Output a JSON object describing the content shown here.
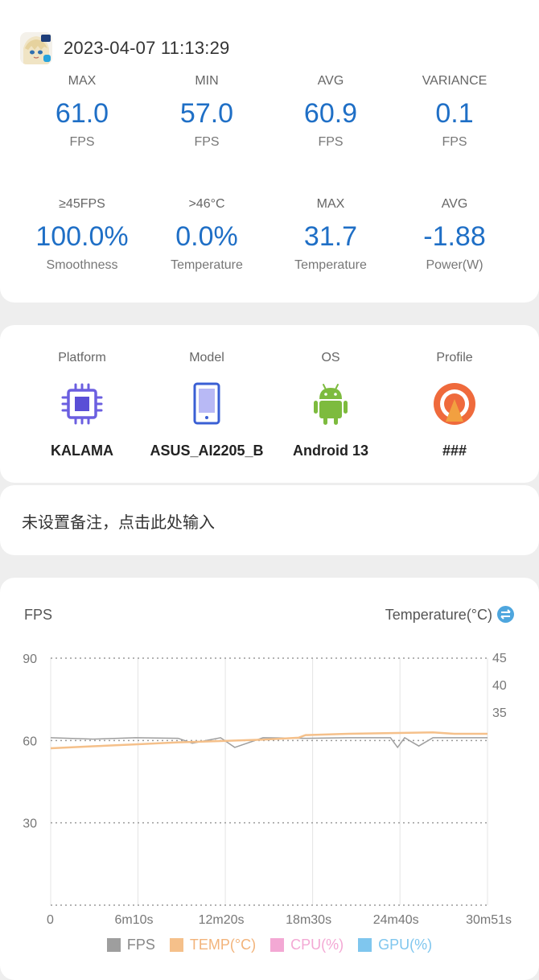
{
  "header": {
    "timestamp": "2023-04-07 11:13:29"
  },
  "metrics_row1": [
    {
      "label": "MAX",
      "value": "61.0",
      "unit": "FPS"
    },
    {
      "label": "MIN",
      "value": "57.0",
      "unit": "FPS"
    },
    {
      "label": "AVG",
      "value": "60.9",
      "unit": "FPS"
    },
    {
      "label": "VARIANCE",
      "value": "0.1",
      "unit": "FPS"
    }
  ],
  "metrics_row2": [
    {
      "label": "≥45FPS",
      "value": "100.0%",
      "unit": "Smoothness"
    },
    {
      "label": ">46°C",
      "value": "0.0%",
      "unit": "Temperature"
    },
    {
      "label": "MAX",
      "value": "31.7",
      "unit": "Temperature"
    },
    {
      "label": "AVG",
      "value": "-1.88",
      "unit": "Power(W)"
    }
  ],
  "device": [
    {
      "label": "Platform",
      "value": "KALAMA",
      "icon": "chip-icon"
    },
    {
      "label": "Model",
      "value": "ASUS_AI2205_B",
      "icon": "phone-icon"
    },
    {
      "label": "OS",
      "value": "Android 13",
      "icon": "android-icon"
    },
    {
      "label": "Profile",
      "value": "###",
      "icon": "profile-icon"
    }
  ],
  "note": {
    "placeholder": "未设置备注，点击此处输入"
  },
  "chart": {
    "left_title": "FPS",
    "right_title": "Temperature(°C)",
    "legend": [
      {
        "name": "FPS",
        "color": "#9e9e9e"
      },
      {
        "name": "TEMP(°C)",
        "color": "#f5c08a"
      },
      {
        "name": "CPU(%)",
        "color": "#f3a8d4"
      },
      {
        "name": "GPU(%)",
        "color": "#7fc6ee"
      }
    ]
  },
  "chart_data": {
    "type": "line",
    "xlabel": "",
    "x_ticks": [
      "0",
      "6m10s",
      "12m20s",
      "18m30s",
      "24m40s",
      "30m51s"
    ],
    "y_left_ticks": [
      "90",
      "60",
      "30"
    ],
    "y_left_range": [
      0,
      90
    ],
    "y_right_ticks": [
      "45",
      "40",
      "35"
    ],
    "y_right_range": [
      30,
      45
    ],
    "series": [
      {
        "name": "FPS",
        "color": "#9e9e9e",
        "x_minutes": [
          0,
          3,
          6,
          9,
          10,
          12,
          13,
          15,
          18,
          21,
          24,
          24.5,
          25,
          26,
          27,
          30.85
        ],
        "values": [
          61,
          60.5,
          61,
          60.8,
          59,
          61,
          57.5,
          61,
          60.8,
          61,
          61,
          57.5,
          61,
          58,
          61,
          61
        ]
      },
      {
        "name": "TEMP(°C)",
        "color": "#f5c08a",
        "x_minutes": [
          0,
          3,
          6,
          9,
          12,
          15,
          17.5,
          18,
          21,
          24,
          27,
          28.5,
          30.85
        ],
        "values": [
          29.0,
          29.3,
          29.6,
          29.9,
          30.1,
          30.3,
          30.6,
          31.0,
          31.2,
          31.3,
          31.4,
          31.2,
          31.2
        ]
      }
    ],
    "grid": true
  }
}
